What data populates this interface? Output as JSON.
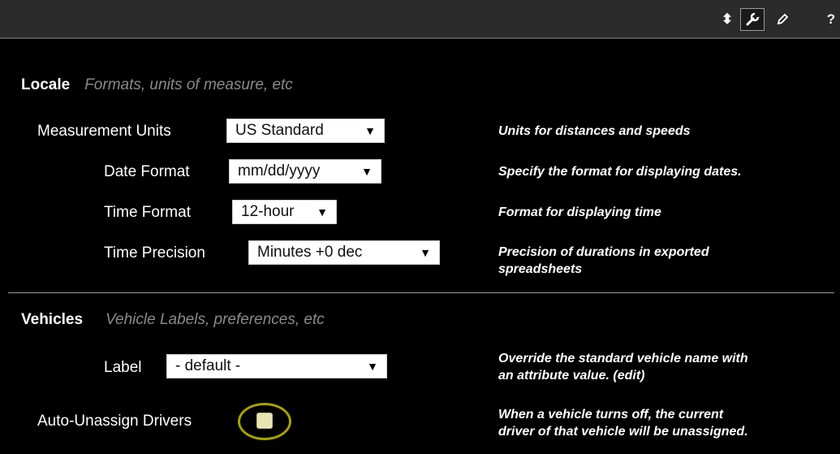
{
  "toolbar": {
    "sort_glyph": "⬍",
    "help_glyph": "?",
    "icons": [
      "sort-icon",
      "wrench-icon",
      "pencil-icon",
      "help-icon"
    ]
  },
  "locale": {
    "title": "Locale",
    "description": "Formats, units of measure, etc",
    "measurement_units": {
      "label": "Measurement Units",
      "value": "US Standard",
      "help": "Units for distances and speeds"
    },
    "date_format": {
      "label": "Date Format",
      "value": "mm/dd/yyyy",
      "help": "Specify the format for displaying dates."
    },
    "time_format": {
      "label": "Time Format",
      "value": "12-hour",
      "help": "Format for displaying time"
    },
    "time_precision": {
      "label": "Time Precision",
      "value": "Minutes +0 dec",
      "help_line1": "Precision of durations in exported",
      "help_line2": "spreadsheets"
    }
  },
  "vehicles": {
    "title": "Vehicles",
    "description": "Vehicle Labels, preferences, etc",
    "label_field": {
      "label": "Label",
      "value": "- default -",
      "help_line1": "Override the standard vehicle name with",
      "help_line2": "an attribute value. (edit)"
    },
    "auto_unassign": {
      "label": "Auto-Unassign Drivers",
      "checked": false,
      "help_line1": "When a vehicle turns off, the current",
      "help_line2": "driver of that vehicle will be unassigned."
    }
  },
  "select_arrow": "▼",
  "colors": {
    "background": "#000000",
    "topbar": "#2b2b2b",
    "highlight_ring": "#a7a300",
    "muted_text": "#8a8a8a"
  }
}
